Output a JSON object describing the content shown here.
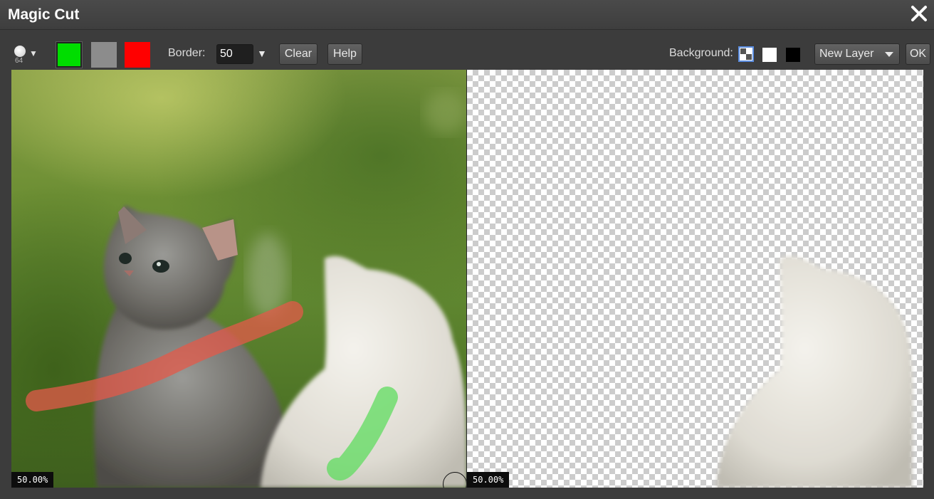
{
  "window": {
    "title": "Magic Cut"
  },
  "icons": {
    "close": "close-icon",
    "brush": "brush-icon",
    "brush_caret": "chevron-down-icon",
    "border_caret": "chevron-down-icon",
    "layer_caret": "chevron-down-icon"
  },
  "toolbar": {
    "brush_size": "64",
    "swatches": [
      {
        "name": "foreground",
        "color": "#00dd00",
        "selected": true
      },
      {
        "name": "unknown",
        "color": "#8c8c8c",
        "selected": false
      },
      {
        "name": "background",
        "color": "#ff0000",
        "selected": false
      }
    ],
    "border_label": "Border:",
    "border_value": "50",
    "clear_label": "Clear",
    "help_label": "Help",
    "background_label": "Background:",
    "background_options": [
      {
        "name": "transparent",
        "selected": true
      },
      {
        "name": "white",
        "color": "#ffffff",
        "selected": false
      },
      {
        "name": "black",
        "color": "#000000",
        "selected": false
      }
    ],
    "layer_select_value": "New Layer",
    "ok_label": "OK"
  },
  "canvas": {
    "left_zoom": "50.00%",
    "right_zoom": "50.00%"
  }
}
